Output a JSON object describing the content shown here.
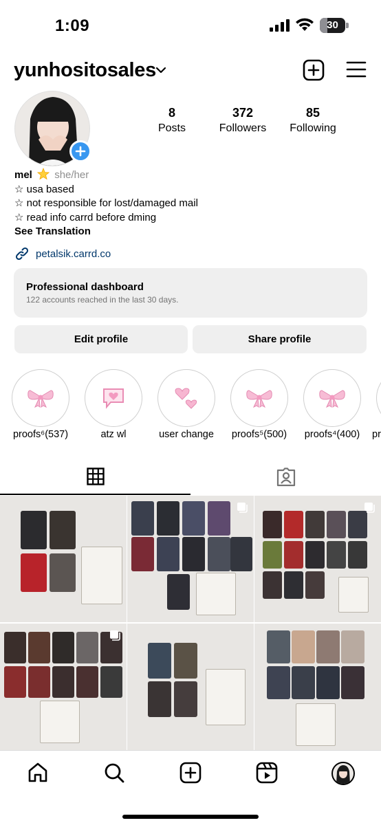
{
  "status": {
    "time": "1:09",
    "battery": "30",
    "battery_level": 0.3
  },
  "header": {
    "username": "yunhositosales"
  },
  "stats": [
    {
      "value": "8",
      "label": "Posts"
    },
    {
      "value": "372",
      "label": "Followers"
    },
    {
      "value": "85",
      "label": "Following"
    }
  ],
  "bio": {
    "name": "mel",
    "pronouns": "she/her",
    "lines": [
      "☆ usa based",
      "☆ not responsible for lost/damaged mail",
      "☆ read info carrd before dming"
    ],
    "see_translation": "See Translation",
    "link": "petalsik.carrd.co"
  },
  "dashboard": {
    "title": "Professional dashboard",
    "subtitle": "122 accounts reached in the last 30 days."
  },
  "buttons": {
    "edit": "Edit profile",
    "share": "Share profile"
  },
  "highlights": [
    {
      "label": "proofs⁶(537)",
      "icon": "bow-icon"
    },
    {
      "label": "atz wl",
      "icon": "speech-heart-icon"
    },
    {
      "label": "user change",
      "icon": "hearts-icon"
    },
    {
      "label": "proofs⁵(500)",
      "icon": "bow-icon"
    },
    {
      "label": "proofs⁴(400)",
      "icon": "bow-icon"
    },
    {
      "label": "pr",
      "icon": "bow-icon"
    }
  ],
  "colors": {
    "accent": "#3897f0",
    "link": "#00376b",
    "bow_pink": "#f4a7c8"
  }
}
